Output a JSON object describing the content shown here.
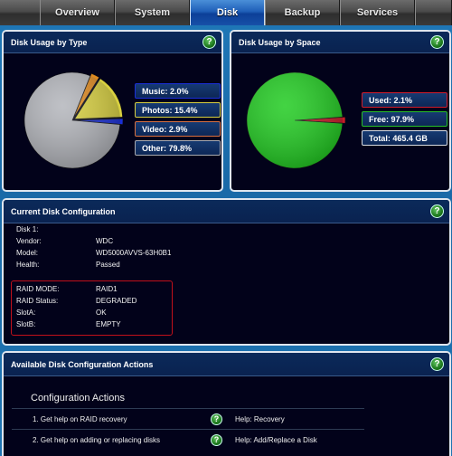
{
  "tabs": [
    {
      "label": "Overview",
      "active": false
    },
    {
      "label": "System",
      "active": false
    },
    {
      "label": "Disk",
      "active": true
    },
    {
      "label": "Backup",
      "active": false
    },
    {
      "label": "Services",
      "active": false
    }
  ],
  "help_glyph": "?",
  "usage_by_type": {
    "title": "Disk Usage by Type",
    "legend": [
      {
        "label": "Music: 2.0%",
        "color": "#1a2fd8"
      },
      {
        "label": "Photos: 15.4%",
        "color": "#d8d040"
      },
      {
        "label": "Video: 2.9%",
        "color": "#d87040"
      },
      {
        "label": "Other: 79.8%",
        "color": "#a8aab0"
      }
    ]
  },
  "usage_by_space": {
    "title": "Disk Usage by Space",
    "legend": [
      {
        "label": "Used: 2.1%",
        "color": "#d01c2a"
      },
      {
        "label": "Free: 97.9%",
        "color": "#28c028"
      },
      {
        "label": "Total: 465.4 GB",
        "color": "#d8dce2"
      }
    ]
  },
  "chart_data": [
    {
      "type": "pie",
      "title": "Disk Usage by Type",
      "categories": [
        "Music",
        "Photos",
        "Video",
        "Other"
      ],
      "values": [
        2.0,
        15.4,
        2.9,
        79.8
      ],
      "colors": [
        "#1a2fd8",
        "#d8d040",
        "#e08a20",
        "#b4b6bc"
      ],
      "legend": "right"
    },
    {
      "type": "pie",
      "title": "Disk Usage by Space",
      "categories": [
        "Used",
        "Free"
      ],
      "values": [
        2.1,
        97.9
      ],
      "colors": [
        "#c81c28",
        "#22cc22"
      ],
      "total": "465.4 GB",
      "legend": "right"
    }
  ],
  "current_config": {
    "title": "Current Disk Configuration",
    "disk_label": "Disk 1:",
    "rows": [
      {
        "key": "Vendor:",
        "value": "WDC"
      },
      {
        "key": "Model:",
        "value": "WD5000AVVS-63H0B1"
      },
      {
        "key": "Health:",
        "value": "Passed"
      }
    ],
    "raid_rows": [
      {
        "key": "RAID MODE:",
        "value": "RAID1"
      },
      {
        "key": "RAID Status:",
        "value": "DEGRADED"
      },
      {
        "key": "SlotA:",
        "value": "OK"
      },
      {
        "key": "SlotB:",
        "value": "EMPTY"
      }
    ]
  },
  "actions": {
    "title": "Available Disk Configuration Actions",
    "subtitle": "Configuration Actions",
    "items": [
      {
        "label": "1. Get help on RAID recovery",
        "link": "Help: Recovery"
      },
      {
        "label": "2. Get help on adding or replacing disks",
        "link": "Help: Add/Replace a Disk"
      }
    ]
  }
}
